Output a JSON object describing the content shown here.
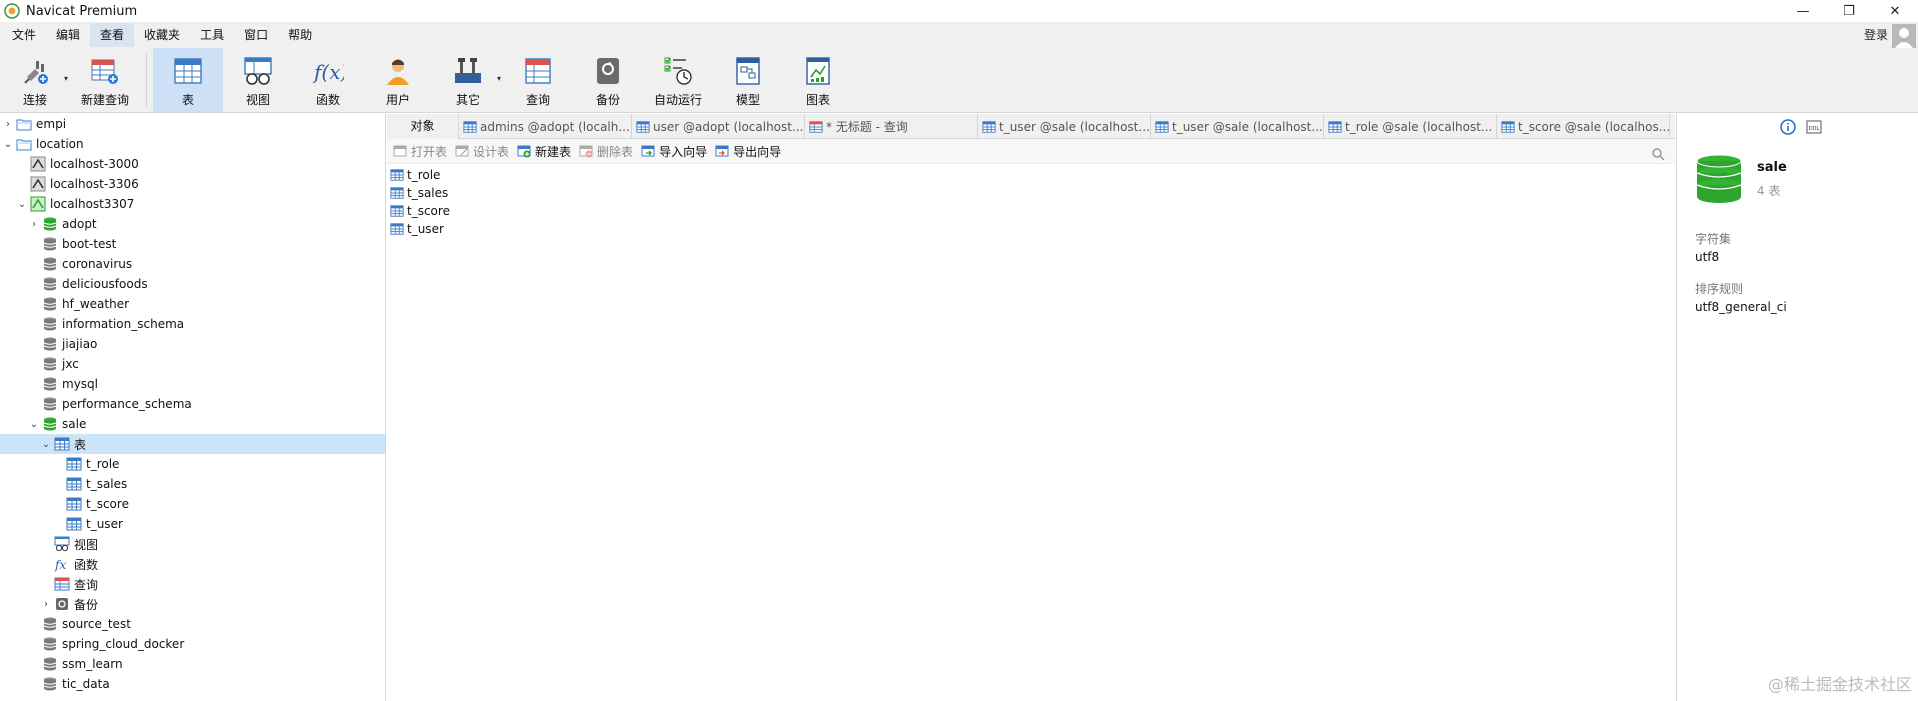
{
  "window": {
    "title": "Navicat Premium",
    "minimize": "—",
    "restore": "❐",
    "close": "✕"
  },
  "menu": {
    "items": [
      "文件",
      "编辑",
      "查看",
      "收藏夹",
      "工具",
      "窗口",
      "帮助"
    ],
    "active_index": 2,
    "login": "登录"
  },
  "toolbar": {
    "buttons": [
      {
        "label": "连接",
        "icon": "plug-icon"
      },
      {
        "label": "新建查询",
        "icon": "new-query-icon"
      },
      {
        "label": "表",
        "icon": "table-icon"
      },
      {
        "label": "视图",
        "icon": "view-icon"
      },
      {
        "label": "函数",
        "icon": "function-icon"
      },
      {
        "label": "用户",
        "icon": "user-icon"
      },
      {
        "label": "其它",
        "icon": "tools-icon"
      },
      {
        "label": "查询",
        "icon": "query-icon"
      },
      {
        "label": "备份",
        "icon": "backup-icon"
      },
      {
        "label": "自动运行",
        "icon": "schedule-icon"
      },
      {
        "label": "模型",
        "icon": "model-icon"
      },
      {
        "label": "图表",
        "icon": "chart-icon"
      }
    ],
    "active_index": 2
  },
  "tree": {
    "nodes": [
      {
        "label": "empi",
        "level": 0,
        "toggle": "›",
        "icon": "folder-icon"
      },
      {
        "label": "location",
        "level": 0,
        "toggle": "⌄",
        "icon": "folder-icon"
      },
      {
        "label": "localhost-3000",
        "level": 1,
        "toggle": "",
        "icon": "mysql-conn-icon"
      },
      {
        "label": "localhost-3306",
        "level": 1,
        "toggle": "",
        "icon": "mysql-conn-icon"
      },
      {
        "label": "localhost3307",
        "level": 1,
        "toggle": "⌄",
        "icon": "mysql-conn-active-icon"
      },
      {
        "label": "adopt",
        "level": 2,
        "toggle": "›",
        "icon": "database-open-icon"
      },
      {
        "label": "boot-test",
        "level": 2,
        "toggle": "",
        "icon": "database-icon"
      },
      {
        "label": "coronavirus",
        "level": 2,
        "toggle": "",
        "icon": "database-icon"
      },
      {
        "label": "deliciousfoods",
        "level": 2,
        "toggle": "",
        "icon": "database-icon"
      },
      {
        "label": "hf_weather",
        "level": 2,
        "toggle": "",
        "icon": "database-icon"
      },
      {
        "label": "information_schema",
        "level": 2,
        "toggle": "",
        "icon": "database-icon"
      },
      {
        "label": "jiajiao",
        "level": 2,
        "toggle": "",
        "icon": "database-icon"
      },
      {
        "label": "jxc",
        "level": 2,
        "toggle": "",
        "icon": "database-icon"
      },
      {
        "label": "mysql",
        "level": 2,
        "toggle": "",
        "icon": "database-icon"
      },
      {
        "label": "performance_schema",
        "level": 2,
        "toggle": "",
        "icon": "database-icon"
      },
      {
        "label": "sale",
        "level": 2,
        "toggle": "⌄",
        "icon": "database-open-icon"
      },
      {
        "label": "表",
        "level": 3,
        "toggle": "⌄",
        "icon": "table-icon",
        "selected": true
      },
      {
        "label": "t_role",
        "level": 4,
        "toggle": "",
        "icon": "table-icon"
      },
      {
        "label": "t_sales",
        "level": 4,
        "toggle": "",
        "icon": "table-icon"
      },
      {
        "label": "t_score",
        "level": 4,
        "toggle": "",
        "icon": "table-icon"
      },
      {
        "label": "t_user",
        "level": 4,
        "toggle": "",
        "icon": "table-icon"
      },
      {
        "label": "视图",
        "level": 3,
        "toggle": "",
        "icon": "view-icon"
      },
      {
        "label": "函数",
        "level": 3,
        "toggle": "",
        "icon": "function-icon"
      },
      {
        "label": "查询",
        "level": 3,
        "toggle": "",
        "icon": "query-icon"
      },
      {
        "label": "备份",
        "level": 3,
        "toggle": "›",
        "icon": "backup-icon"
      },
      {
        "label": "source_test",
        "level": 2,
        "toggle": "",
        "icon": "database-icon"
      },
      {
        "label": "spring_cloud_docker",
        "level": 2,
        "toggle": "",
        "icon": "database-icon"
      },
      {
        "label": "ssm_learn",
        "level": 2,
        "toggle": "",
        "icon": "database-icon"
      },
      {
        "label": "tic_data",
        "level": 2,
        "toggle": "",
        "icon": "database-icon"
      }
    ]
  },
  "tabs": {
    "object_tab": "对象",
    "items": [
      {
        "label": "admins @adopt (localh...",
        "icon": "table-icon"
      },
      {
        "label": "user @adopt (localhost...",
        "icon": "table-icon"
      },
      {
        "label": "* 无标题 - 查询",
        "icon": "query-icon"
      },
      {
        "label": "t_user @sale (localhost...",
        "icon": "table-icon"
      },
      {
        "label": "t_user @sale (localhost...",
        "icon": "table-icon"
      },
      {
        "label": "t_role @sale (localhost...",
        "icon": "table-icon"
      },
      {
        "label": "t_score @sale (localhos...",
        "icon": "table-icon"
      }
    ]
  },
  "object_toolbar": {
    "buttons": [
      {
        "label": "打开表",
        "enabled": false,
        "icon": "open-table-icon"
      },
      {
        "label": "设计表",
        "enabled": false,
        "icon": "design-table-icon"
      },
      {
        "label": "新建表",
        "enabled": true,
        "icon": "new-table-icon"
      },
      {
        "label": "删除表",
        "enabled": false,
        "icon": "delete-table-icon"
      },
      {
        "label": "导入向导",
        "enabled": true,
        "icon": "import-icon"
      },
      {
        "label": "导出向导",
        "enabled": true,
        "icon": "export-icon"
      }
    ]
  },
  "objects": [
    "t_role",
    "t_sales",
    "t_score",
    "t_user"
  ],
  "info_panel": {
    "name": "sale",
    "count": "4 表",
    "charset_label": "字符集",
    "charset_value": "utf8",
    "collation_label": "排序规则",
    "collation_value": "utf8_general_ci"
  },
  "watermark": "@稀土掘金技术社区",
  "colors": {
    "accent": "#cde0f5",
    "db_green": "#2e9e2e",
    "table_blue": "#3b7bc4"
  }
}
